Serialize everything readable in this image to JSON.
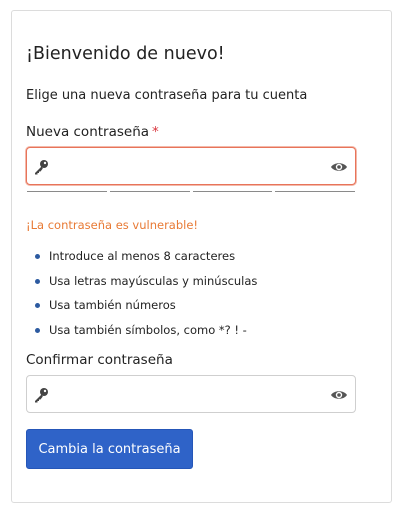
{
  "form": {
    "title": "¡Bienvenido de nuevo!",
    "subtitle": "Elige una nueva contraseña para tu cuenta",
    "new_password": {
      "label": "Nueva contraseña",
      "required_mark": "*",
      "value": "",
      "placeholder": ""
    },
    "strength_segments": 4,
    "warning": "¡La contraseña es vulnerable!",
    "rules": [
      "Introduce al menos 8 caracteres",
      "Usa letras mayúsculas y minúsculas",
      "Usa también números",
      "Usa también símbolos, como *? ! -"
    ],
    "confirm_password": {
      "label": "Confirmar contraseña",
      "value": "",
      "placeholder": ""
    },
    "submit_label": "Cambia la contraseña"
  },
  "colors": {
    "primary_button": "#2f63c8",
    "error_border": "#e8745a",
    "warning_text": "#e87a35",
    "required_mark": "#d9363e",
    "bullet": "#2c5aa0"
  },
  "icons": {
    "field_leading": "key-icon",
    "field_trailing": "eye-icon"
  }
}
